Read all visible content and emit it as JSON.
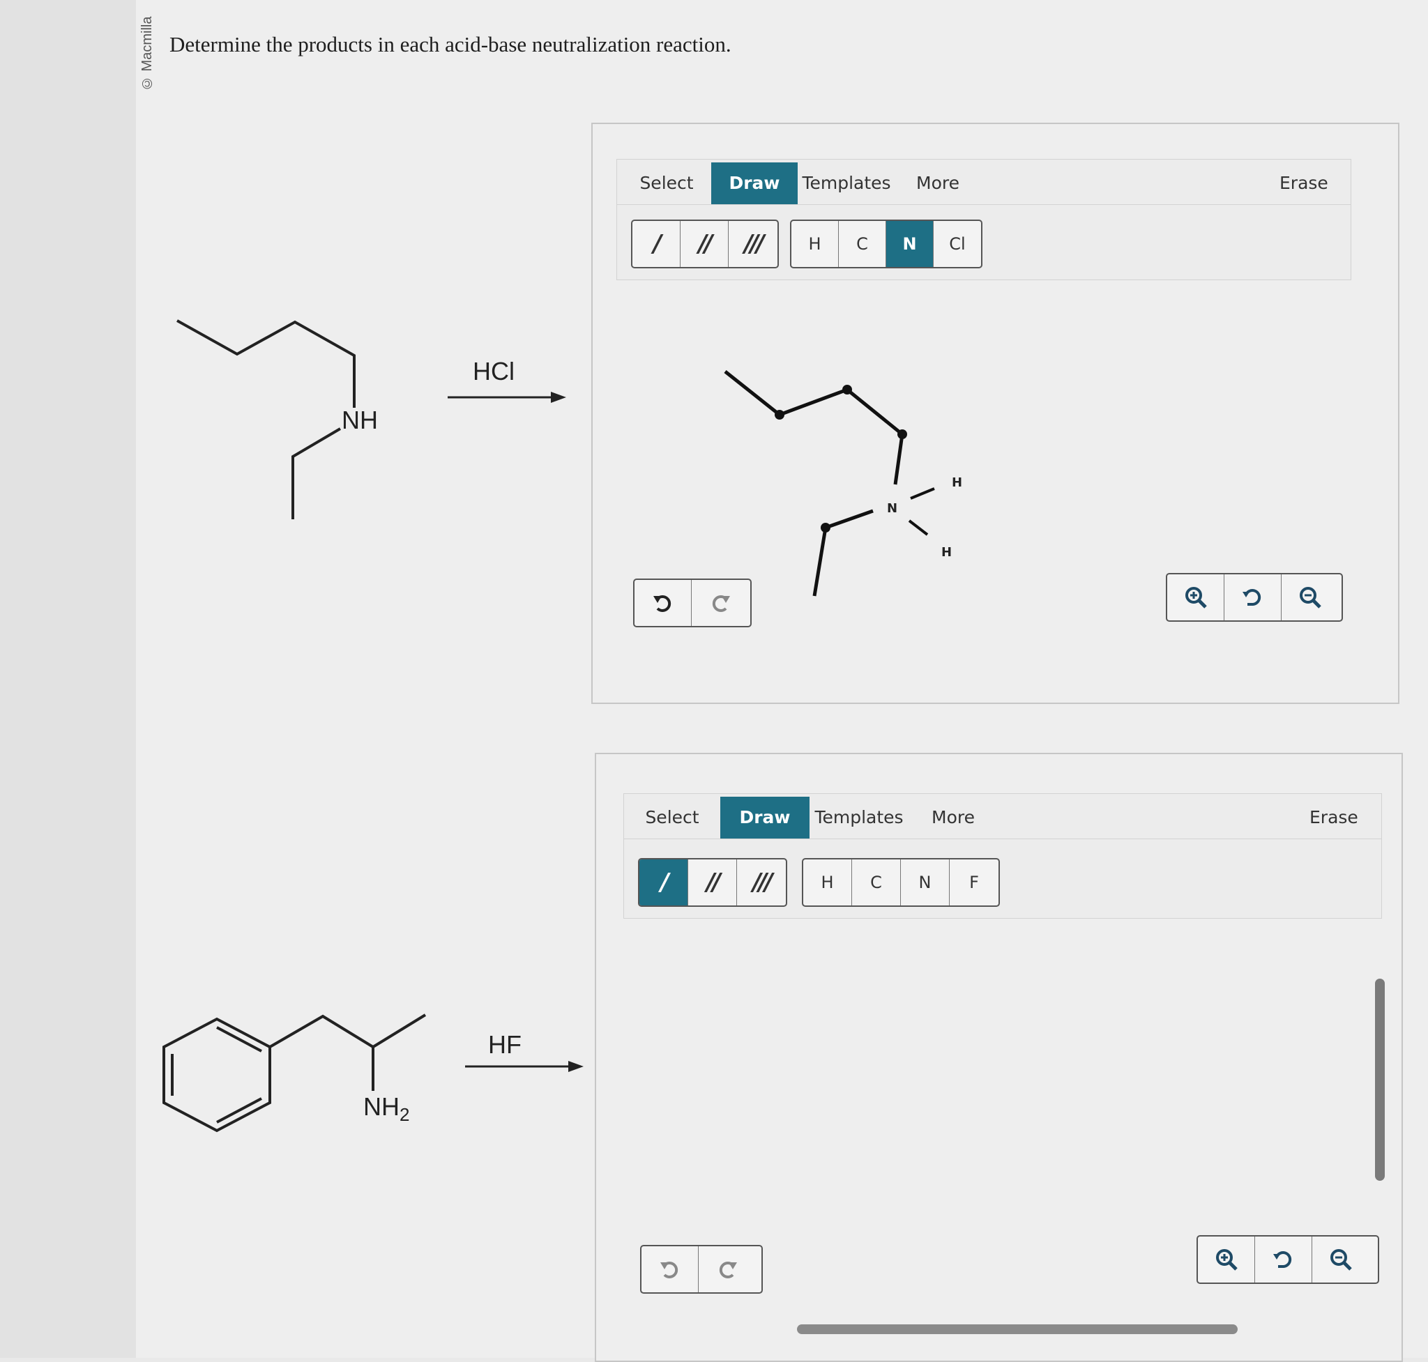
{
  "watermark": "© Macmilla",
  "question": "Determine the products in each acid-base neutralization reaction.",
  "reactions": [
    {
      "reactant_label": "NH",
      "reagent": "HCl",
      "editor": {
        "tabs": {
          "select": "Select",
          "draw": "Draw",
          "templates": "Templates",
          "more": "More",
          "erase": "Erase"
        },
        "active_tab": "Draw",
        "bond_buttons": [
          "/",
          "//",
          "///"
        ],
        "atom_buttons": [
          "H",
          "C",
          "N",
          "Cl"
        ],
        "active_button": "N",
        "drawn_atoms": {
          "n": "N",
          "h1": "H",
          "h2": "H"
        }
      }
    },
    {
      "reactant_label": "NH",
      "reactant_subscript": "2",
      "reagent": "HF",
      "editor": {
        "tabs": {
          "select": "Select",
          "draw": "Draw",
          "templates": "Templates",
          "more": "More",
          "erase": "Erase"
        },
        "active_tab": "Draw",
        "bond_buttons": [
          "/",
          "//",
          "///"
        ],
        "atom_buttons": [
          "H",
          "C",
          "N",
          "F"
        ],
        "active_button": "/"
      }
    }
  ],
  "controls": {
    "undo_icon": "undo-icon",
    "redo_icon": "redo-icon",
    "zoom_in_icon": "zoom-in-icon",
    "reset_icon": "reset-zoom-icon",
    "zoom_out_icon": "zoom-out-icon"
  },
  "colors": {
    "accent": "#1e6f85",
    "background": "#eeeeee"
  }
}
